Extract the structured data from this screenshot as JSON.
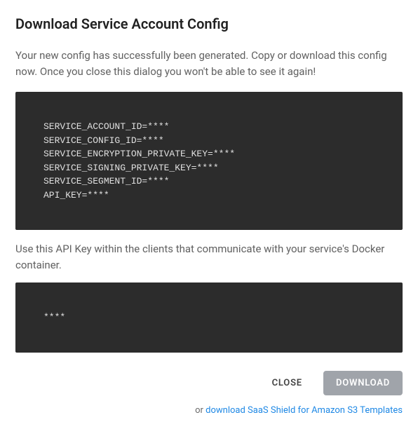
{
  "dialog": {
    "title": "Download Service Account Config",
    "description": "Your new config has successfully been generated. Copy or download this config now. Once you close this dialog you won't be able to see it again!",
    "config_block": "SERVICE_ACCOUNT_ID=****\nSERVICE_CONFIG_ID=****\nSERVICE_ENCRYPTION_PRIVATE_KEY=****\nSERVICE_SIGNING_PRIVATE_KEY=****\nSERVICE_SEGMENT_ID=****\nAPI_KEY=****",
    "api_key_note": "Use this API Key within the clients that communicate with your service's Docker container.",
    "api_key_block": "****",
    "buttons": {
      "close": "CLOSE",
      "download": "DOWNLOAD"
    },
    "template_row": {
      "prefix": "or  ",
      "link_text": "download SaaS Shield for Amazon S3 Templates"
    }
  }
}
